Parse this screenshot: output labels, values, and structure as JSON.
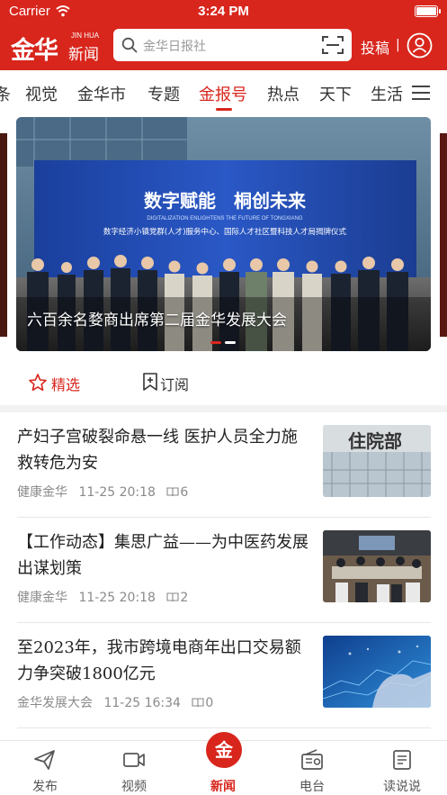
{
  "status_bar": {
    "carrier": "Carrier",
    "time": "3:24 PM"
  },
  "header": {
    "logo_main": "金华",
    "logo_en": "JIN HUA",
    "logo_sub": "新闻",
    "search_placeholder": "金华日报社",
    "post_label": "投稿",
    "separator": "|",
    "accent_color": "#d8261d"
  },
  "tabs": {
    "items": [
      "条",
      "视觉",
      "金华市",
      "专题",
      "金报号",
      "热点",
      "天下",
      "生活"
    ],
    "active": "金报号"
  },
  "carousel": {
    "caption": "六百余名婺商出席第二届金华发展大会",
    "banner_title": "数字赋能　桐创未来",
    "banner_en": "DIGITALIZATION ENLIGHTENS THE FUTURE OF TONGXIANG",
    "banner_sub": "数字经济小镇党群(人才)服务中心、国际人才社区暨科技人才局揭牌仪式",
    "page_count": 2,
    "active_page": 2
  },
  "channel_bar": {
    "featured": "精选",
    "subscribe": "订阅"
  },
  "articles": [
    {
      "title": "产妇子宫破裂命悬一线  医护人员全力施救转危为安",
      "source": "健康金华",
      "time": "11-25 20:18",
      "reads": "6",
      "thumb_icon": "hospital-photo",
      "thumb_text": "住院部"
    },
    {
      "title": "【工作动态】集思广益——为中医药发展出谋划策",
      "source": "健康金华",
      "time": "11-25 20:18",
      "reads": "2",
      "thumb_icon": "meeting-room-photo"
    },
    {
      "title": "至2023年，我市跨境电商年出口交易额力争突破1800亿元",
      "source": "金华发展大会",
      "time": "11-25 16:34",
      "reads": "0",
      "thumb_icon": "digital-hand-photo"
    }
  ],
  "bottom_nav": {
    "items": [
      {
        "label": "发布",
        "icon": "send-icon"
      },
      {
        "label": "视频",
        "icon": "video-icon"
      },
      {
        "label": "新闻",
        "icon": "news-logo-icon",
        "glyph": "金"
      },
      {
        "label": "电台",
        "icon": "radio-icon"
      },
      {
        "label": "读说说",
        "icon": "document-icon"
      }
    ],
    "active": "新闻"
  }
}
